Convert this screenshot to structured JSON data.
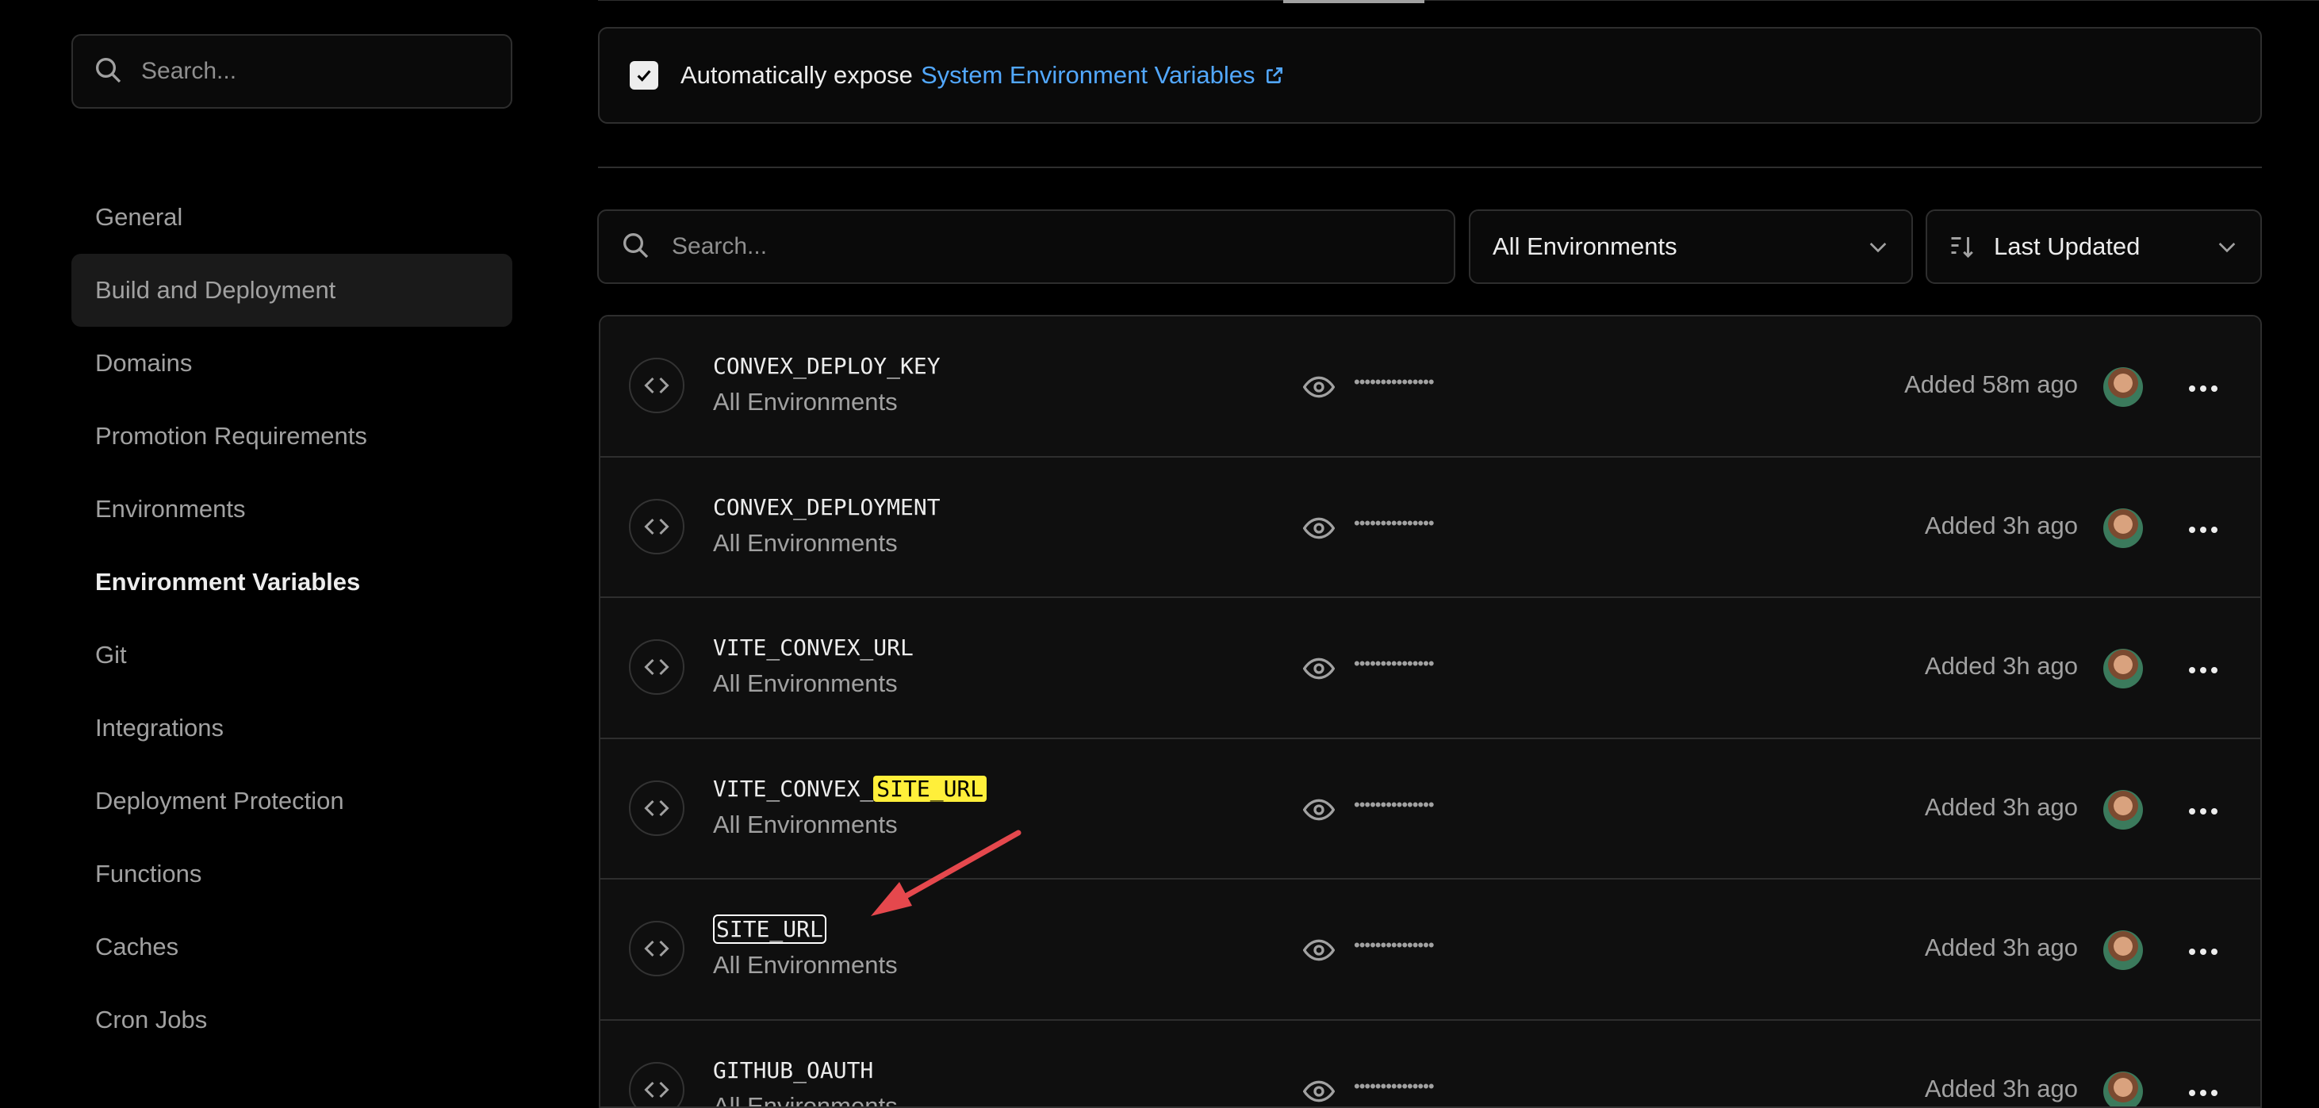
{
  "sidebar": {
    "search_placeholder": "Search...",
    "items": [
      {
        "label": "General"
      },
      {
        "label": "Build and Deployment"
      },
      {
        "label": "Domains"
      },
      {
        "label": "Promotion Requirements"
      },
      {
        "label": "Environments"
      },
      {
        "label": "Environment Variables"
      },
      {
        "label": "Git"
      },
      {
        "label": "Integrations"
      },
      {
        "label": "Deployment Protection"
      },
      {
        "label": "Functions"
      },
      {
        "label": "Caches"
      },
      {
        "label": "Cron Jobs"
      }
    ],
    "hovered_item": "Build and Deployment",
    "active_item": "Environment Variables"
  },
  "expose": {
    "checked": true,
    "text": "Automatically expose",
    "link": "System Environment Variables"
  },
  "filters": {
    "search_placeholder": "Search...",
    "environment": "All Environments",
    "sort": "Last Updated"
  },
  "variables": [
    {
      "name": "CONVEX_DEPLOY_KEY",
      "env": "All Environments",
      "value_masked": "•••••••••••••••",
      "added": "Added 58m ago"
    },
    {
      "name": "CONVEX_DEPLOYMENT",
      "env": "All Environments",
      "value_masked": "•••••••••••••••",
      "added": "Added 3h ago"
    },
    {
      "name": "VITE_CONVEX_URL",
      "env": "All Environments",
      "value_masked": "•••••••••••••••",
      "added": "Added 3h ago"
    },
    {
      "name_prefix": "VITE_CONVEX_",
      "name_highlight": "SITE_URL",
      "env": "All Environments",
      "value_masked": "•••••••••••••••",
      "added": "Added 3h ago"
    },
    {
      "name": "SITE_URL",
      "env": "All Environments",
      "value_masked": "•••••••••••••••",
      "added": "Added 3h ago"
    },
    {
      "name": "GITHUB_OAUTH",
      "env": "All Environments",
      "value_masked": "•••••••••••••••",
      "added": "Added 3h ago"
    }
  ],
  "colors": {
    "accent_link": "#52a8ff",
    "highlight": "#ffef3a",
    "annotation_arrow": "#e5484d"
  }
}
